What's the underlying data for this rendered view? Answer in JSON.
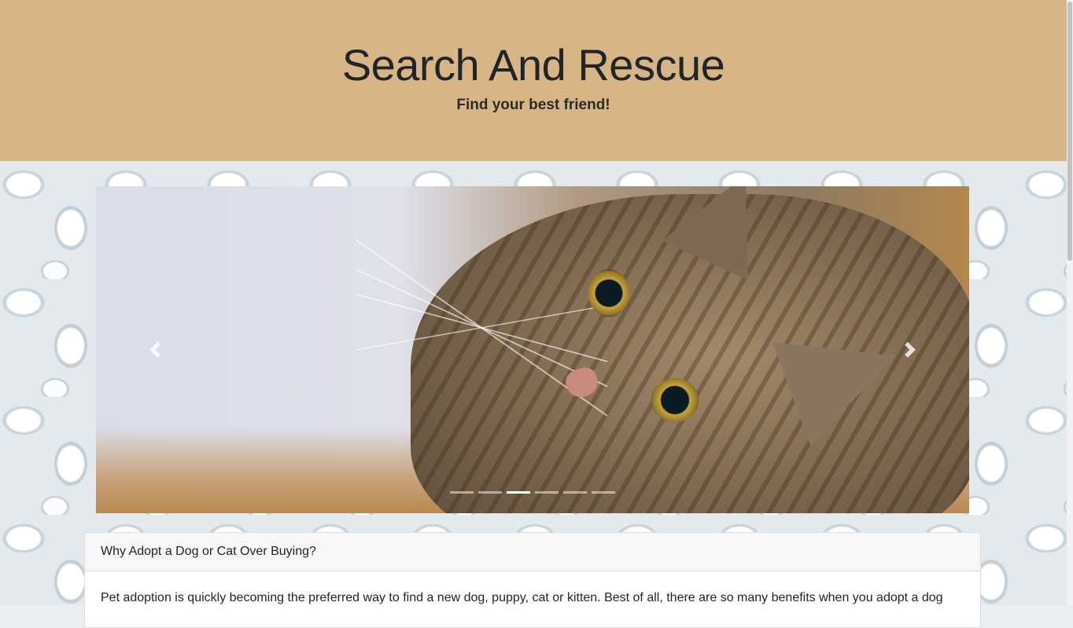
{
  "header": {
    "title": "Search And Rescue",
    "subtitle": "Find your best friend!",
    "background_color": "#d8b586"
  },
  "carousel": {
    "slide_image_subject": "tabby-kitten-photo",
    "prev_icon": "chevron-left-icon",
    "next_icon": "chevron-right-icon",
    "indicator_count": 6,
    "active_indicator": 3
  },
  "card": {
    "header": "Why Adopt a Dog or Cat Over Buying?",
    "body": "Pet adoption is quickly becoming the preferred way to find a new dog, puppy, cat or kitten. Best of all, there are so many benefits when you adopt a dog"
  }
}
